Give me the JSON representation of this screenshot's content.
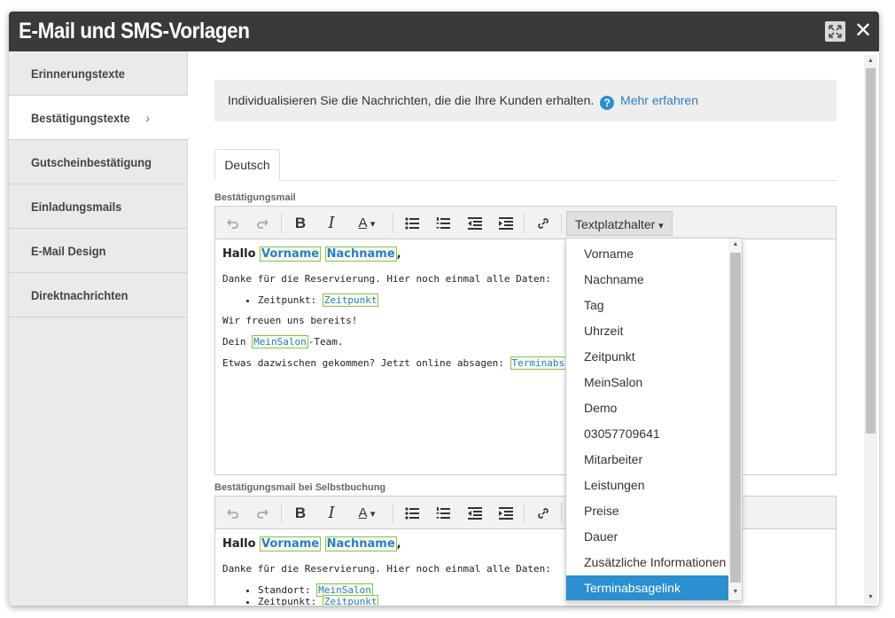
{
  "window": {
    "title": "E-Mail und SMS-Vorlagen"
  },
  "sidebar": {
    "items": [
      {
        "label": "Erinnerungstexte"
      },
      {
        "label": "Bestätigungstexte",
        "chevron": "›"
      },
      {
        "label": "Gutscheinbestätigung"
      },
      {
        "label": "Einladungsmails"
      },
      {
        "label": "E-Mail Design"
      },
      {
        "label": "Direktnachrichten"
      }
    ]
  },
  "info": {
    "text": "Individualisieren Sie die Nachrichten, die die Ihre Kunden erhalten.",
    "help_glyph": "?",
    "link": "Mehr erfahren"
  },
  "tabs": [
    {
      "label": "Deutsch"
    }
  ],
  "editor1": {
    "label": "Bestätigungsmail",
    "dropdown_label": "Textplatzhalter",
    "greeting": "Hallo",
    "ph_vorname": "Vorname",
    "ph_nachname": "Nachname",
    "comma": ",",
    "line1": "Danke für die Reservierung. Hier noch einmal alle Daten:",
    "bullet_label": "Zeitpunkt:",
    "ph_zeitpunkt": "Zeitpunkt",
    "line2": "Wir freuen uns bereits!",
    "dein": "Dein",
    "ph_salon": "MeinSalon",
    "team": "-Team.",
    "line3": "Etwas dazwischen gekommen? Jetzt online absagen:",
    "ph_absage": "Terminabsage"
  },
  "editor2": {
    "label": "Bestätigungsmail bei Selbstbuchung",
    "greeting": "Hallo",
    "ph_vorname": "Vorname",
    "ph_nachname": "Nachname",
    "comma": ",",
    "line1": "Danke für die Reservierung. Hier noch einmal alle Daten:",
    "bullet_label": "Standort:",
    "ph_salon": "MeinSalon",
    "bullet2_label": "Zeitpunkt:",
    "ph_zeitpunkt": "Zeitpunkt"
  },
  "dropdown": {
    "items": [
      "Vorname",
      "Nachname",
      "Tag",
      "Uhrzeit",
      "Zeitpunkt",
      "MeinSalon",
      "Demo",
      "03057709641",
      "Mitarbeiter",
      "Leistungen",
      "Preise",
      "Dauer",
      "Zusätzliche Informationen",
      "Terminabsagelink"
    ],
    "selected": "Terminabsagelink"
  },
  "icons": {
    "undo": "undo-icon",
    "redo": "redo-icon",
    "bold": "bold-icon",
    "italic": "italic-icon",
    "font_color": "font-color-icon",
    "bullet_list": "bullet-list-icon",
    "numbered_list": "numbered-list-icon",
    "outdent": "outdent-icon",
    "indent": "indent-icon",
    "link": "link-icon",
    "expand": "expand-icon",
    "close": "close-icon"
  },
  "toolbar_glyphs": {
    "bold": "B",
    "italic": "I",
    "font_color": "A",
    "caret": "▾",
    "close": "✕",
    "scroll_up": "▲",
    "scroll_down": "▼"
  },
  "colors": {
    "titlebar": "#3a3a3a",
    "accent": "#2b8fd0",
    "placeholder_border": "#8bc34a",
    "link": "#2b7fc2"
  }
}
